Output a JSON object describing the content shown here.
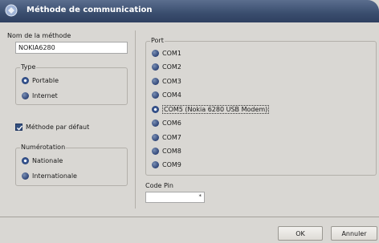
{
  "window": {
    "title": "Méthode de communication"
  },
  "name_field": {
    "label": "Nom de la méthode",
    "value": "NOKIA6280"
  },
  "type_group": {
    "legend": "Type",
    "options": [
      {
        "label": "Portable",
        "checked": true
      },
      {
        "label": "Internet",
        "checked": false
      }
    ]
  },
  "default_checkbox": {
    "label": "Méthode par défaut",
    "checked": true
  },
  "numbering_group": {
    "legend": "Numérotation",
    "options": [
      {
        "label": "Nationale",
        "checked": true
      },
      {
        "label": "Internationale",
        "checked": false
      }
    ]
  },
  "port_group": {
    "legend": "Port",
    "options": [
      {
        "label": "COM1",
        "checked": false
      },
      {
        "label": "COM2",
        "checked": false
      },
      {
        "label": "COM3",
        "checked": false
      },
      {
        "label": "COM4",
        "checked": false
      },
      {
        "label": "COM5 (Nokia 6280 USB Modem)",
        "checked": true
      },
      {
        "label": "COM6",
        "checked": false
      },
      {
        "label": "COM7",
        "checked": false
      },
      {
        "label": "COM8",
        "checked": false
      },
      {
        "label": "COM9",
        "checked": false
      }
    ]
  },
  "pin_field": {
    "label": "Code Pin",
    "value": "*"
  },
  "buttons": {
    "ok": "OK",
    "cancel": "Annuler"
  }
}
